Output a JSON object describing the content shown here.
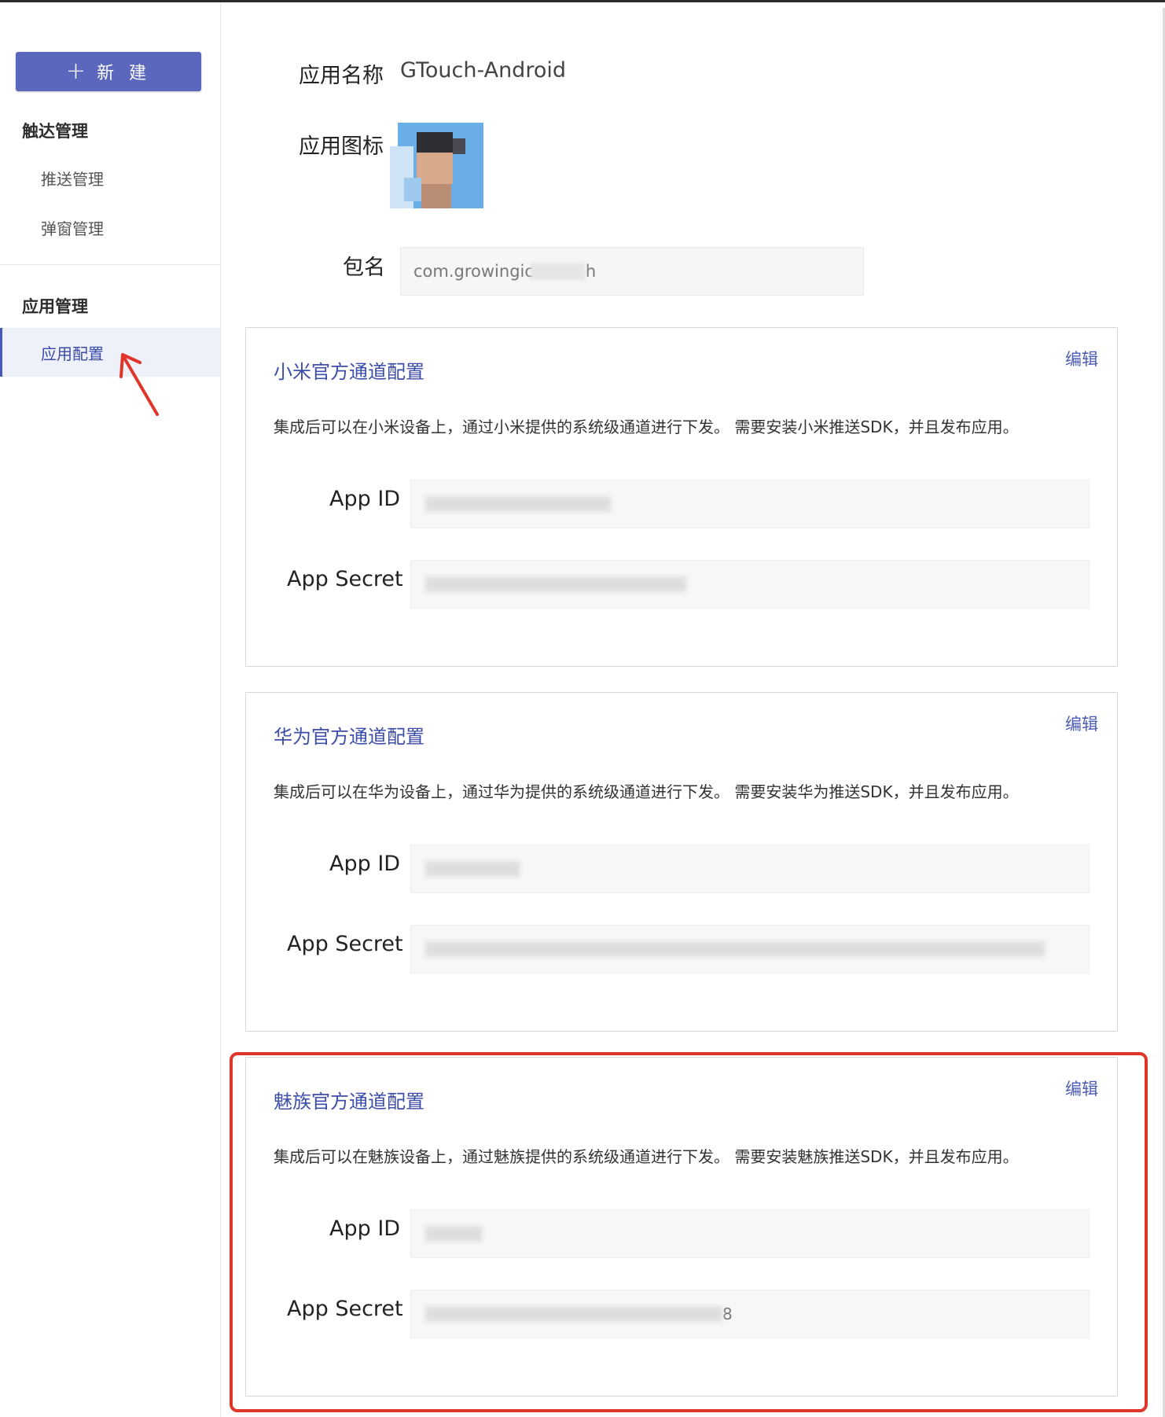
{
  "sidebar": {
    "new_button": "新 建",
    "groups": [
      {
        "title": "触达管理",
        "items": [
          "推送管理",
          "弹窗管理"
        ]
      },
      {
        "title": "应用管理",
        "items": [
          "应用配置"
        ]
      }
    ],
    "active_item": "应用配置"
  },
  "app_info": {
    "name_label": "应用名称",
    "name_value": "GTouch-Android",
    "icon_label": "应用图标",
    "package_label": "包名",
    "package_value": "com.growingic",
    "package_value_tail": "h"
  },
  "cards": [
    {
      "title": "小米官方通道配置",
      "edit": "编辑",
      "description": "集成后可以在小米设备上，通过小米提供的系统级通道进行下发。 需要安装小米推送SDK，并且发布应用。",
      "app_id_label": "App ID",
      "app_secret_label": "App Secret"
    },
    {
      "title": "华为官方通道配置",
      "edit": "编辑",
      "description": "集成后可以在华为设备上，通过华为提供的系统级通道进行下发。 需要安装华为推送SDK，并且发布应用。",
      "app_id_label": "App ID",
      "app_secret_label": "App Secret"
    },
    {
      "title": "魅族官方通道配置",
      "edit": "编辑",
      "description": "集成后可以在魅族设备上，通过魅族提供的系统级通道进行下发。 需要安装魅族推送SDK，并且发布应用。",
      "app_id_label": "App ID",
      "app_secret_label": "App Secret",
      "app_secret_tail": "8"
    }
  ],
  "colors": {
    "accent": "#5a67bd",
    "title_blue": "#3d4ea8",
    "highlight_red": "#e0352b"
  }
}
